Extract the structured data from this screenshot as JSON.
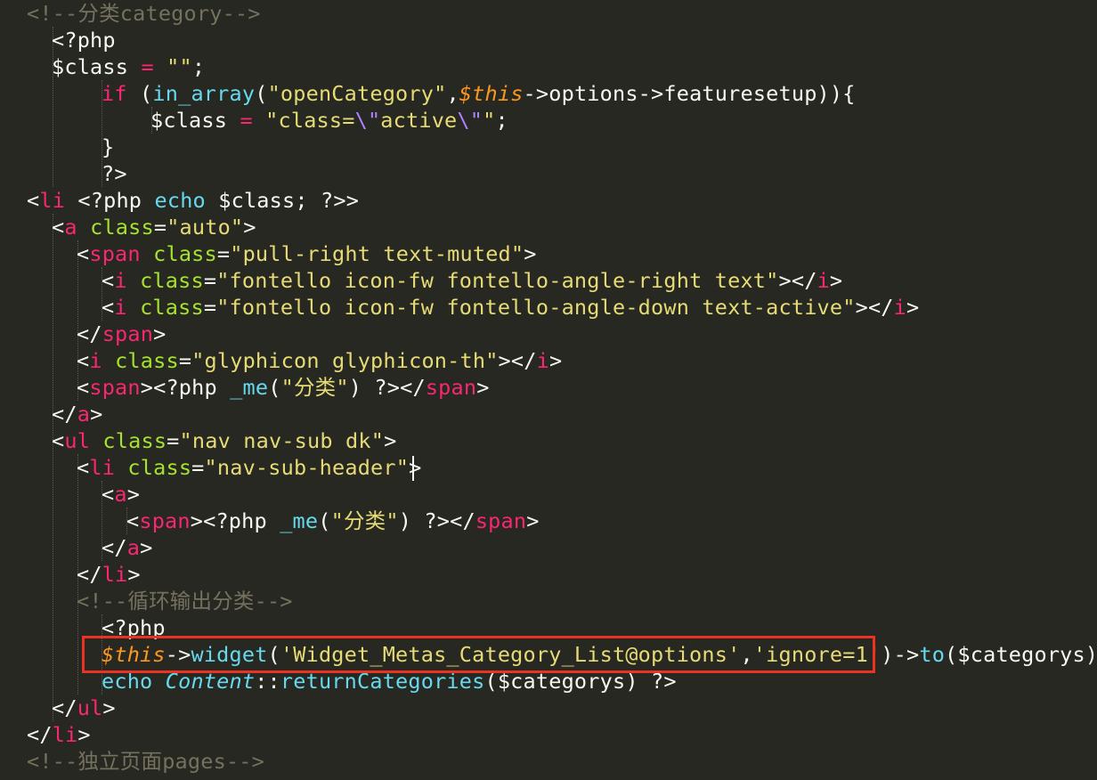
{
  "editor": {
    "language": "PHP / HTML template",
    "theme_colors": {
      "background": "#272822",
      "text": "#f8f8f2",
      "comment": "#75715e",
      "tag": "#f92672",
      "attribute": "#a6e22e",
      "string": "#e6db74",
      "function": "#66d9ef",
      "variable_this": "#fd971f",
      "highlight_box": "#ea3323"
    },
    "cursor_line": 18,
    "highlighted_line": 24
  },
  "lines": [
    [
      [
        "c",
        "<!--分类category-->"
      ]
    ],
    [
      [
        "p",
        "<?php"
      ]
    ],
    [
      [
        "p",
        "$class "
      ],
      [
        "t",
        "="
      ],
      [
        "p",
        " "
      ],
      [
        "s",
        "\"\""
      ],
      [
        "p",
        ";"
      ]
    ],
    [
      [
        "t",
        "if"
      ],
      [
        "p",
        " ("
      ],
      [
        "f",
        "in_array"
      ],
      [
        "p",
        "("
      ],
      [
        "s",
        "\"openCategory\""
      ],
      [
        "p",
        ","
      ],
      [
        "v",
        "$this"
      ],
      [
        "p",
        "->options->featuresetup)){"
      ]
    ],
    [
      [
        "p",
        "$class "
      ],
      [
        "t",
        "="
      ],
      [
        "p",
        " "
      ],
      [
        "s",
        "\"class="
      ],
      [
        "e",
        "\\\""
      ],
      [
        "s",
        "active"
      ],
      [
        "e",
        "\\\""
      ],
      [
        "s",
        "\""
      ],
      [
        "p",
        ";"
      ]
    ],
    [
      [
        "p",
        "}"
      ]
    ],
    [
      [
        "p",
        "?>"
      ]
    ],
    [
      [
        "p",
        "<"
      ],
      [
        "t",
        "li"
      ],
      [
        "p",
        " <?php "
      ],
      [
        "f",
        "echo"
      ],
      [
        "p",
        " $class; ?>>"
      ]
    ],
    [
      [
        "p",
        "<"
      ],
      [
        "t",
        "a"
      ],
      [
        "p",
        " "
      ],
      [
        "a",
        "class"
      ],
      [
        "p",
        "="
      ],
      [
        "s",
        "\"auto\""
      ],
      [
        "p",
        ">"
      ]
    ],
    [
      [
        "p",
        "<"
      ],
      [
        "t",
        "span"
      ],
      [
        "p",
        " "
      ],
      [
        "a",
        "class"
      ],
      [
        "p",
        "="
      ],
      [
        "s",
        "\"pull-right text-muted\""
      ],
      [
        "p",
        ">"
      ]
    ],
    [
      [
        "p",
        "<"
      ],
      [
        "t",
        "i"
      ],
      [
        "p",
        " "
      ],
      [
        "a",
        "class"
      ],
      [
        "p",
        "="
      ],
      [
        "s",
        "\"fontello icon-fw fontello-angle-right text\""
      ],
      [
        "p",
        "></"
      ],
      [
        "t",
        "i"
      ],
      [
        "p",
        ">"
      ]
    ],
    [
      [
        "p",
        "<"
      ],
      [
        "t",
        "i"
      ],
      [
        "p",
        " "
      ],
      [
        "a",
        "class"
      ],
      [
        "p",
        "="
      ],
      [
        "s",
        "\"fontello icon-fw fontello-angle-down text-active\""
      ],
      [
        "p",
        "></"
      ],
      [
        "t",
        "i"
      ],
      [
        "p",
        ">"
      ]
    ],
    [
      [
        "p",
        "</"
      ],
      [
        "t",
        "span"
      ],
      [
        "p",
        ">"
      ]
    ],
    [
      [
        "p",
        "<"
      ],
      [
        "t",
        "i"
      ],
      [
        "p",
        " "
      ],
      [
        "a",
        "class"
      ],
      [
        "p",
        "="
      ],
      [
        "s",
        "\"glyphicon glyphicon-th\""
      ],
      [
        "p",
        "></"
      ],
      [
        "t",
        "i"
      ],
      [
        "p",
        ">"
      ]
    ],
    [
      [
        "p",
        "<"
      ],
      [
        "t",
        "span"
      ],
      [
        "p",
        "><?php "
      ],
      [
        "f",
        "_me"
      ],
      [
        "p",
        "("
      ],
      [
        "s",
        "\"分类\""
      ],
      [
        "p",
        ") ?></"
      ],
      [
        "t",
        "span"
      ],
      [
        "p",
        ">"
      ]
    ],
    [
      [
        "p",
        "</"
      ],
      [
        "t",
        "a"
      ],
      [
        "p",
        ">"
      ]
    ],
    [
      [
        "p",
        "<"
      ],
      [
        "t",
        "ul"
      ],
      [
        "p",
        " "
      ],
      [
        "a",
        "class"
      ],
      [
        "p",
        "="
      ],
      [
        "s",
        "\"nav nav-sub dk\""
      ],
      [
        "p",
        ">"
      ]
    ],
    [
      [
        "p",
        "<"
      ],
      [
        "t",
        "li"
      ],
      [
        "p",
        " "
      ],
      [
        "a",
        "class"
      ],
      [
        "p",
        "="
      ],
      [
        "s",
        "\"nav-sub-header\""
      ],
      [
        "p",
        ">"
      ]
    ],
    [
      [
        "p",
        "<"
      ],
      [
        "t",
        "a"
      ],
      [
        "p",
        ">"
      ]
    ],
    [
      [
        "p",
        "<"
      ],
      [
        "t",
        "span"
      ],
      [
        "p",
        "><?php "
      ],
      [
        "f",
        "_me"
      ],
      [
        "p",
        "("
      ],
      [
        "s",
        "\"分类\""
      ],
      [
        "p",
        ") ?></"
      ],
      [
        "t",
        "span"
      ],
      [
        "p",
        ">"
      ]
    ],
    [
      [
        "p",
        "</"
      ],
      [
        "t",
        "a"
      ],
      [
        "p",
        ">"
      ]
    ],
    [
      [
        "p",
        "</"
      ],
      [
        "t",
        "li"
      ],
      [
        "p",
        ">"
      ]
    ],
    [
      [
        "c",
        "<!--循环输出分类-->"
      ]
    ],
    [
      [
        "p",
        "<?php"
      ]
    ],
    [
      [
        "v",
        "$this"
      ],
      [
        "p",
        "->"
      ],
      [
        "f",
        "widget"
      ],
      [
        "p",
        "("
      ],
      [
        "s",
        "'Widget_Metas_Category_List@options'"
      ],
      [
        "p",
        ","
      ],
      [
        "s",
        "'ignore=1'"
      ],
      [
        "p",
        ")->"
      ],
      [
        "f",
        "to"
      ],
      [
        "p",
        "($categorys);"
      ]
    ],
    [
      [
        "f",
        "echo"
      ],
      [
        "p",
        " "
      ],
      [
        "i",
        "Content"
      ],
      [
        "p",
        "::"
      ],
      [
        "f",
        "returnCategories"
      ],
      [
        "p",
        "($categorys) ?>"
      ]
    ],
    [
      [
        "p",
        "</"
      ],
      [
        "t",
        "ul"
      ],
      [
        "p",
        ">"
      ]
    ],
    [
      [
        "p",
        "</"
      ],
      [
        "t",
        "li"
      ],
      [
        "p",
        ">"
      ]
    ],
    [
      [
        "c",
        "<!--独立页面pages-->"
      ]
    ]
  ]
}
